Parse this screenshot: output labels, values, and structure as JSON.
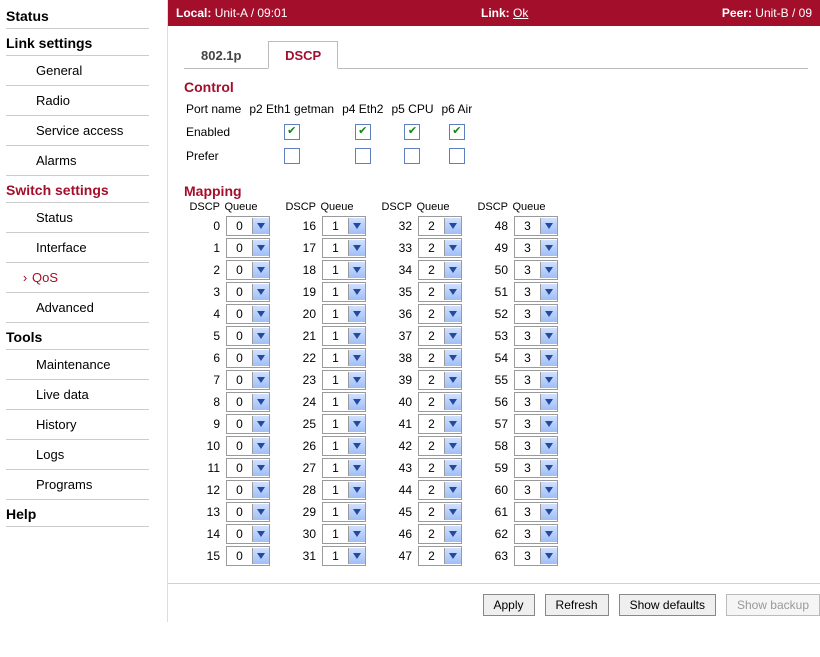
{
  "topbar": {
    "local_label": "Local:",
    "local_val": "Unit-A / 09:01",
    "link_label": "Link:",
    "link_val": "Ok",
    "peer_label": "Peer:",
    "peer_val": "Unit-B / 09"
  },
  "sidebar": {
    "status": "Status",
    "link_settings": "Link settings",
    "link_items": [
      "General",
      "Radio",
      "Service access",
      "Alarms"
    ],
    "switch_settings": "Switch settings",
    "switch_items": [
      "Status",
      "Interface",
      "QoS",
      "Advanced"
    ],
    "switch_active_index": 2,
    "tools": "Tools",
    "tools_items": [
      "Maintenance",
      "Live data",
      "History",
      "Logs",
      "Programs"
    ],
    "help": "Help"
  },
  "tabs": {
    "a": "802.1p",
    "b": "DSCP",
    "active": "b"
  },
  "control": {
    "title": "Control",
    "row_port": "Port name",
    "row_enabled": "Enabled",
    "row_prefer": "Prefer",
    "ports": [
      "p2 Eth1 getman",
      "p4 Eth2",
      "p5 CPU",
      "p6 Air"
    ],
    "enabled": [
      true,
      true,
      true,
      true
    ],
    "prefer": [
      false,
      false,
      false,
      false
    ]
  },
  "mapping": {
    "title": "Mapping",
    "dscp_label": "DSCP",
    "queue_label": "Queue"
  },
  "chart_data": {
    "type": "table",
    "title": "DSCP to Queue mapping",
    "columns": [
      "DSCP",
      "Queue"
    ],
    "rows": [
      [
        0,
        0
      ],
      [
        1,
        0
      ],
      [
        2,
        0
      ],
      [
        3,
        0
      ],
      [
        4,
        0
      ],
      [
        5,
        0
      ],
      [
        6,
        0
      ],
      [
        7,
        0
      ],
      [
        8,
        0
      ],
      [
        9,
        0
      ],
      [
        10,
        0
      ],
      [
        11,
        0
      ],
      [
        12,
        0
      ],
      [
        13,
        0
      ],
      [
        14,
        0
      ],
      [
        15,
        0
      ],
      [
        16,
        1
      ],
      [
        17,
        1
      ],
      [
        18,
        1
      ],
      [
        19,
        1
      ],
      [
        20,
        1
      ],
      [
        21,
        1
      ],
      [
        22,
        1
      ],
      [
        23,
        1
      ],
      [
        24,
        1
      ],
      [
        25,
        1
      ],
      [
        26,
        1
      ],
      [
        27,
        1
      ],
      [
        28,
        1
      ],
      [
        29,
        1
      ],
      [
        30,
        1
      ],
      [
        31,
        1
      ],
      [
        32,
        2
      ],
      [
        33,
        2
      ],
      [
        34,
        2
      ],
      [
        35,
        2
      ],
      [
        36,
        2
      ],
      [
        37,
        2
      ],
      [
        38,
        2
      ],
      [
        39,
        2
      ],
      [
        40,
        2
      ],
      [
        41,
        2
      ],
      [
        42,
        2
      ],
      [
        43,
        2
      ],
      [
        44,
        2
      ],
      [
        45,
        2
      ],
      [
        46,
        2
      ],
      [
        47,
        2
      ],
      [
        48,
        3
      ],
      [
        49,
        3
      ],
      [
        50,
        3
      ],
      [
        51,
        3
      ],
      [
        52,
        3
      ],
      [
        53,
        3
      ],
      [
        54,
        3
      ],
      [
        55,
        3
      ],
      [
        56,
        3
      ],
      [
        57,
        3
      ],
      [
        58,
        3
      ],
      [
        59,
        3
      ],
      [
        60,
        3
      ],
      [
        61,
        3
      ],
      [
        62,
        3
      ],
      [
        63,
        3
      ]
    ]
  },
  "buttons": {
    "apply": "Apply",
    "refresh": "Refresh",
    "defaults": "Show defaults",
    "backup": "Show backup"
  }
}
